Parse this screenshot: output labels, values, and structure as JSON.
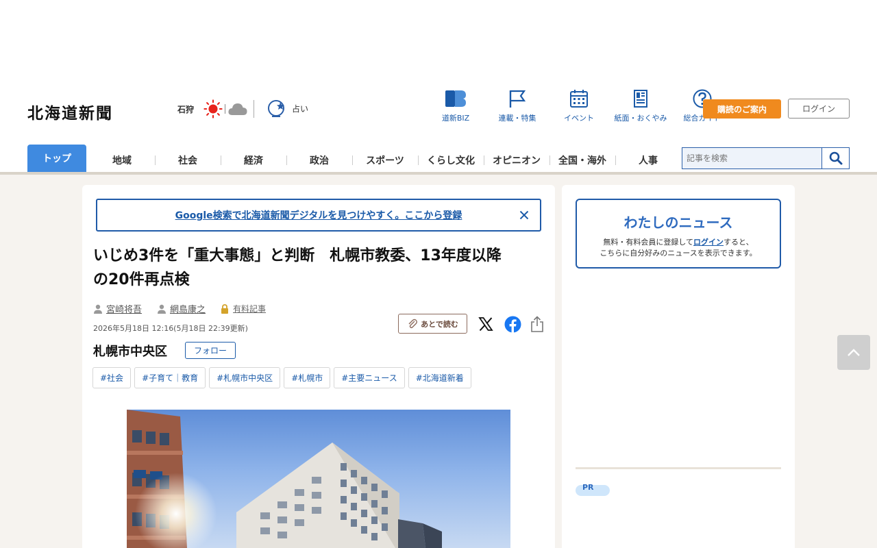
{
  "header": {
    "logo": "北海道新聞",
    "weather_area": "石狩",
    "fortune_label": "占い",
    "nav_icons": [
      "道新BIZ",
      "連載・特集",
      "イベント",
      "紙面・おくやみ",
      "総合ガイド"
    ],
    "subscribe_label": "購読のご案内",
    "login_label": "ログイン"
  },
  "gnav": {
    "items": [
      "トップ",
      "地域",
      "社会",
      "経済",
      "政治",
      "スポーツ",
      "くらし文化",
      "オピニオン",
      "全国・海外",
      "人事"
    ],
    "search_placeholder": "記事を検索"
  },
  "banner": {
    "text": "Google検索で北海道新聞デジタルを見つけやすく。ここから登録"
  },
  "article": {
    "headline_line1": "いじめ3件を「重大事態」と判断　札幌市教委、13年度以降",
    "headline_line2": "の20件再点検",
    "authors": [
      "宮崎将吾",
      "網島康之"
    ],
    "paid_label": "有料記事",
    "date": "2026年5月18日 12:16(5月18日 22:39更新)",
    "read_later": "あとで読む",
    "place": "札幌市中央区",
    "follow_label": "フォロー",
    "tags": [
      "#社会",
      "#子育て｜教育",
      "#札幌市中央区",
      "#札幌市",
      "#主要ニュース",
      "#北海道新着"
    ]
  },
  "sidebar": {
    "mynews_title": "わたしのニュース",
    "mynews_desc_pre": "無料・有料会員に登録して",
    "mynews_login": "ログイン",
    "mynews_desc_post": "すると、",
    "mynews_desc_line2": "こちらに自分好みのニュースを表示できます。",
    "pr_label": "PR"
  },
  "colors": {
    "brand_blue": "#1a5aa8",
    "accent_orange": "#f08a1e",
    "nav_active": "#3f8ae0"
  }
}
